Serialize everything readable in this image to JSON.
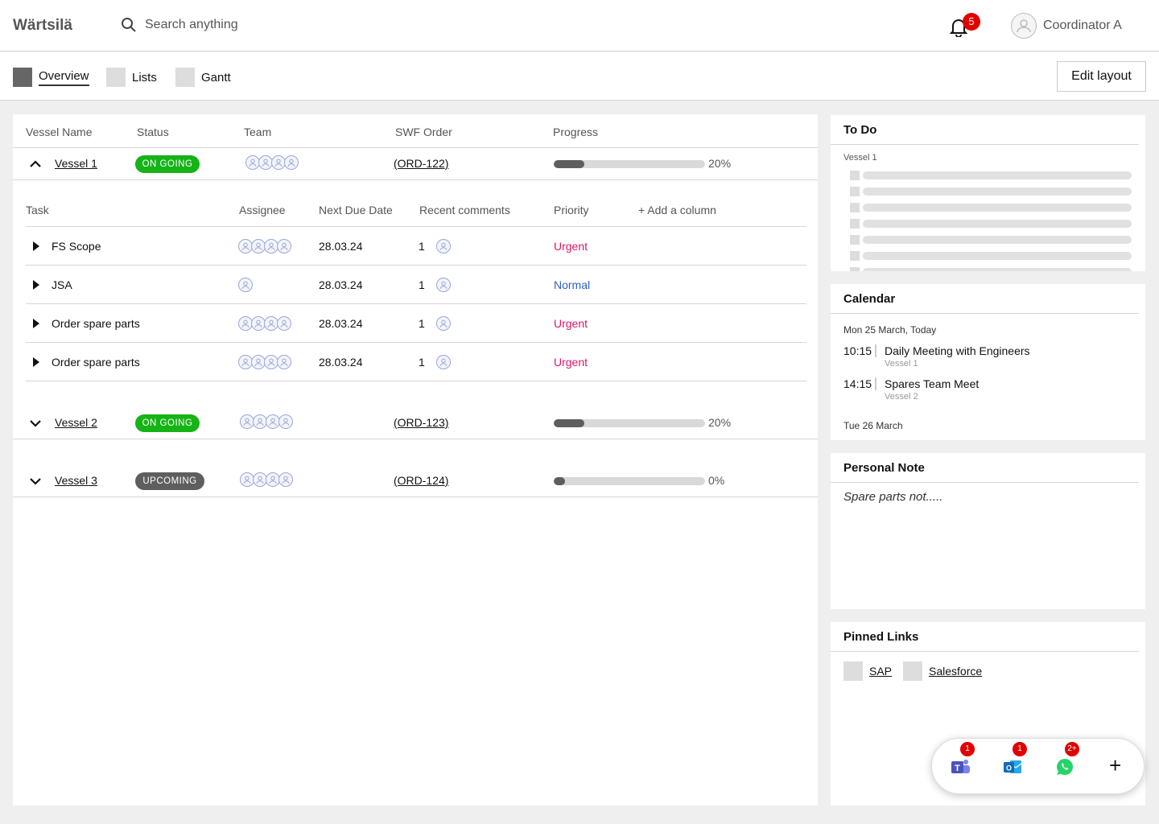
{
  "header": {
    "logo": "Wärtsilä",
    "search_placeholder": "Search anything",
    "notifications": "5",
    "user": "Coordinator A"
  },
  "tabs": [
    {
      "label": "Overview",
      "active": true
    },
    {
      "label": "Lists",
      "active": false
    },
    {
      "label": "Gantt",
      "active": false
    }
  ],
  "edit_layout": "Edit layout",
  "table": {
    "columns": [
      "Vessel Name",
      "Status",
      "Team",
      "SWF Order",
      "Progress"
    ],
    "task_columns": [
      "Task",
      "Assignee",
      "Next Due Date",
      "Recent comments",
      "Priority"
    ],
    "add_column": "+ Add a column",
    "vessels": [
      {
        "name": "Vessel 1",
        "status": "ON GOING",
        "order": "(ORD-122)",
        "progress": 0.2,
        "progress_text": "20%",
        "expanded": true
      },
      {
        "name": "Vessel 2",
        "status": "ON GOING",
        "order": "(ORD-123)",
        "progress": 0.2,
        "progress_text": "20%",
        "expanded": false
      },
      {
        "name": "Vessel 3",
        "status": "UPCOMING",
        "order": "(ORD-124)",
        "progress": 0.0,
        "progress_text": "0%",
        "expanded": false
      }
    ],
    "tasks": [
      {
        "name": "FS Scope",
        "due": "28.03.24",
        "comments": "1",
        "priority": "Urgent"
      },
      {
        "name": "JSA",
        "due": "28.03.24",
        "comments": "1",
        "priority": "Normal"
      },
      {
        "name": "Order spare parts",
        "due": "28.03.24",
        "comments": "1",
        "priority": "Urgent"
      },
      {
        "name": "Order spare parts",
        "due": "28.03.24",
        "comments": "1",
        "priority": "Urgent"
      }
    ]
  },
  "todo": {
    "title": "To Do",
    "vessel": "Vessel 1"
  },
  "calendar": {
    "title": "Calendar",
    "day1": "Mon 25 March, Today",
    "events": [
      {
        "time": "10:15",
        "title": "Daily Meeting with Engineers",
        "vessel": "Vessel 1"
      },
      {
        "time": "14:15",
        "title": "Spares Team Meet",
        "vessel": "Vessel 2"
      }
    ],
    "day2": "Tue 26 March"
  },
  "note": {
    "title": "Personal Note",
    "text": "Spare parts not....."
  },
  "links": {
    "title": "Pinned Links",
    "items": [
      "SAP",
      "Salesforce"
    ]
  },
  "dock": {
    "teams_badge": "1",
    "outlook_badge": "1",
    "whatsapp_badge": "2+",
    "add": "+"
  },
  "colors": {
    "ongoing": "#16b316",
    "upcoming": "#5e5e5e",
    "urgent": "#e0156b",
    "normal": "#2d5ec6",
    "badge": "#e00000"
  }
}
